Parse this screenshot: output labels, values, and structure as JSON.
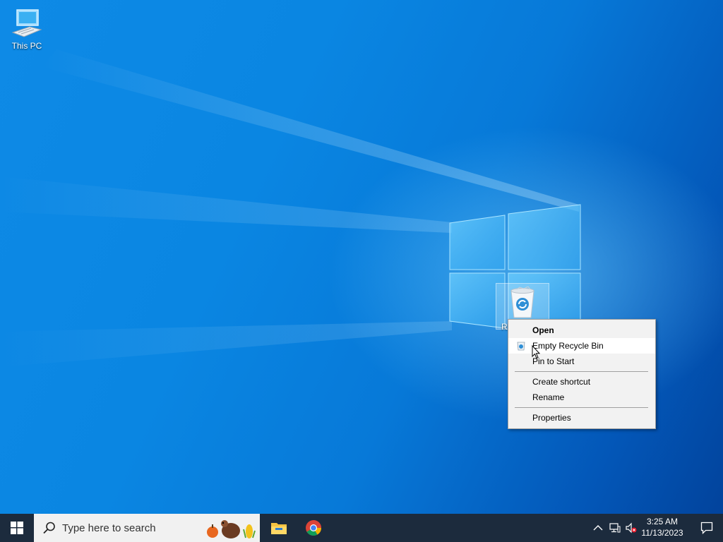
{
  "desktop": {
    "icons": [
      {
        "label": "This PC"
      },
      {
        "label": "R"
      }
    ]
  },
  "context_menu": {
    "items": [
      {
        "label": "Open",
        "bold": true
      },
      {
        "label": "Empty Recycle Bin"
      },
      {
        "label": "Pin to Start"
      },
      {
        "label": "Create shortcut"
      },
      {
        "label": "Rename"
      },
      {
        "label": "Properties"
      }
    ]
  },
  "taskbar": {
    "search_placeholder": "Type here to search",
    "clock": {
      "time": "3:25 AM",
      "date": "11/13/2023"
    }
  },
  "colors": {
    "accent": "#0a78d7",
    "taskbar": "#1c2b3d",
    "menu_bg": "#f2f2f2"
  }
}
